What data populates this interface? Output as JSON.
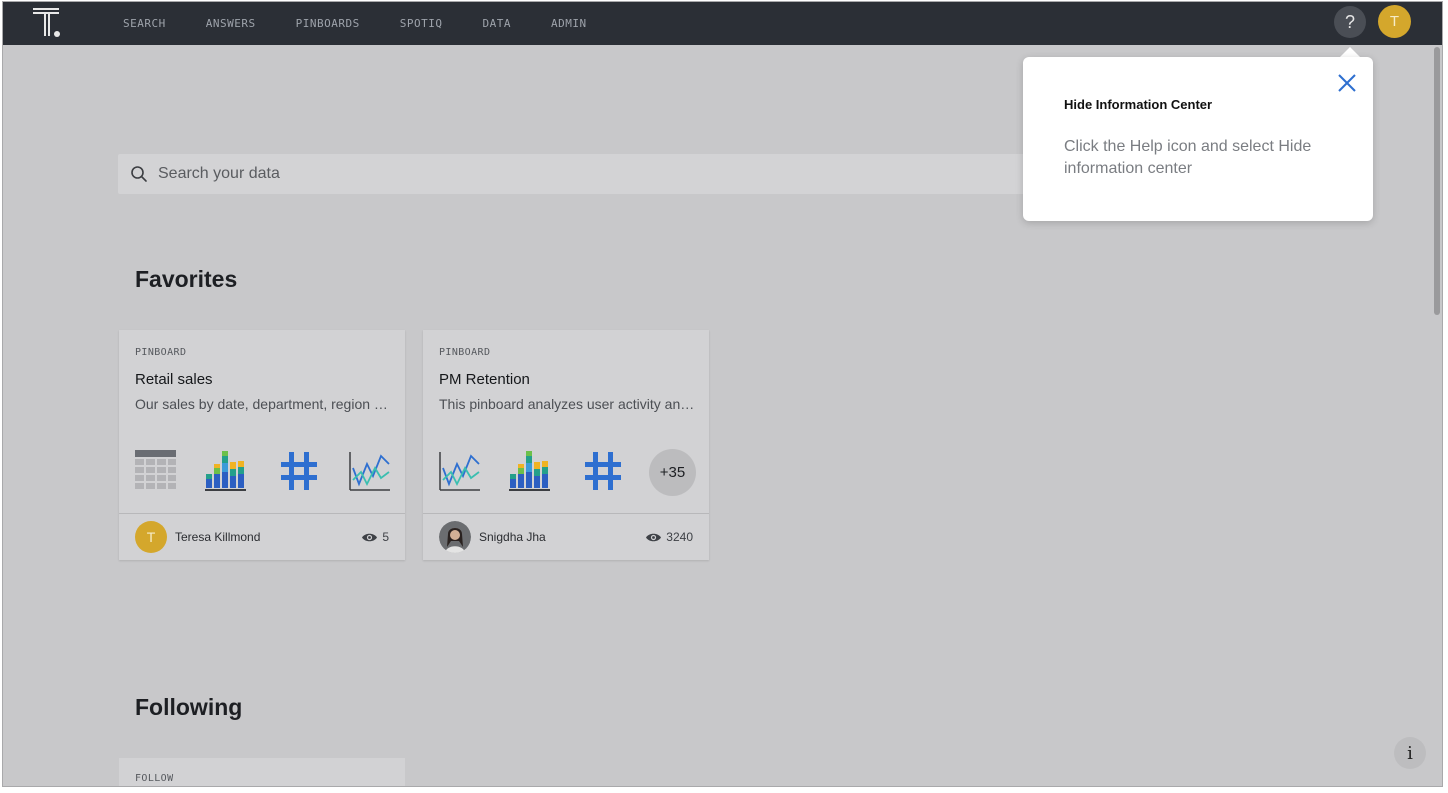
{
  "nav": {
    "items": [
      {
        "label": "SEARCH"
      },
      {
        "label": "ANSWERS"
      },
      {
        "label": "PINBOARDS"
      },
      {
        "label": "SPOTIQ"
      },
      {
        "label": "DATA"
      },
      {
        "label": "ADMIN"
      }
    ],
    "help_label": "?",
    "user_initial": "T"
  },
  "search": {
    "placeholder": "Search your data"
  },
  "sections": {
    "favorites_title": "Favorites",
    "following_title": "Following"
  },
  "favorites": [
    {
      "type": "PINBOARD",
      "title": "Retail sales",
      "description": "Our sales by date, department, region and more",
      "owner_initial": "T",
      "owner": "Teresa Killmond",
      "views": "5",
      "thumbnails": [
        "table-icon",
        "stacked-bar-icon",
        "number-icon",
        "line-chart-icon"
      ]
    },
    {
      "type": "PINBOARD",
      "title": "PM Retention",
      "description": "This pinboard analyzes user activity and retention",
      "owner": "Snigdha Jha",
      "views": "3240",
      "more_count": "+35",
      "thumbnails": [
        "line-chart-icon",
        "stacked-bar-icon",
        "number-icon"
      ]
    }
  ],
  "following": [
    {
      "type": "FOLLOW"
    }
  ],
  "popover": {
    "title": "Hide Information Center",
    "body": "Click the Help icon and select Hide information center"
  },
  "info_label": "i",
  "colors": {
    "topnav": "#2b2f36",
    "accent_blue": "#2e6fd0",
    "avatar_gold": "#d4a72c"
  }
}
